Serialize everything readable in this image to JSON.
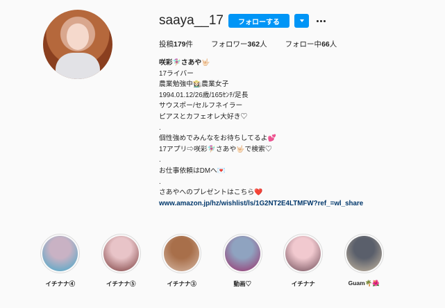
{
  "profile": {
    "username": "saaya__17",
    "follow_label": "フォローする",
    "stats": {
      "posts_label": "投稿",
      "posts_value": "179",
      "posts_unit": "件",
      "followers_label": "フォロワー",
      "followers_value": "362",
      "followers_unit": "人",
      "following_label": "フォロー中",
      "following_value": "66",
      "following_unit": "人"
    },
    "bio": {
      "name": "咲彩🧚🏼‍♀️さあや🤟🏻",
      "lines": [
        "17ライバー",
        "農業勉強中👩🏻‍🌾農業女子",
        "1994.01.12/26歳/165ｾﾝﾁ/足長",
        "サウスポー/セルフネイラー",
        "ピアスとカフェオレ大好き♡",
        ".",
        "個性強めでみんなをお待ちしてるよ💕",
        "17アプリ⇨咲彩🧚🏼‍♀️さあや🤟🏻で検索♡",
        ".",
        "お仕事依頼はDMへ💌",
        ".",
        "さあやへのプレゼントはこちら❤️"
      ],
      "link": "www.amazon.jp/hz/wishlist/ls/1G2NT2E4LTMFW?ref_=wl_share"
    }
  },
  "highlights": [
    {
      "label": "イチナナ④",
      "color_a": "#c9b2c4",
      "color_b": "#3fa7c9"
    },
    {
      "label": "イチナナ⑤",
      "color_a": "#e8c4c8",
      "color_b": "#7a3b3b"
    },
    {
      "label": "イチナナ③",
      "color_a": "#a86f4a",
      "color_b": "#d7b9a6"
    },
    {
      "label": "動画♡",
      "color_a": "#8fa3c0",
      "color_b": "#9a2e6a"
    },
    {
      "label": "イチナナ",
      "color_a": "#f1c9cf",
      "color_b": "#6d4a56"
    },
    {
      "label": "Guam🌴🌺",
      "color_a": "#5a5f6b",
      "color_b": "#c8b9a2"
    }
  ],
  "colors": {
    "accent": "#0095f6",
    "link": "#00376b",
    "background": "#fafafa"
  }
}
